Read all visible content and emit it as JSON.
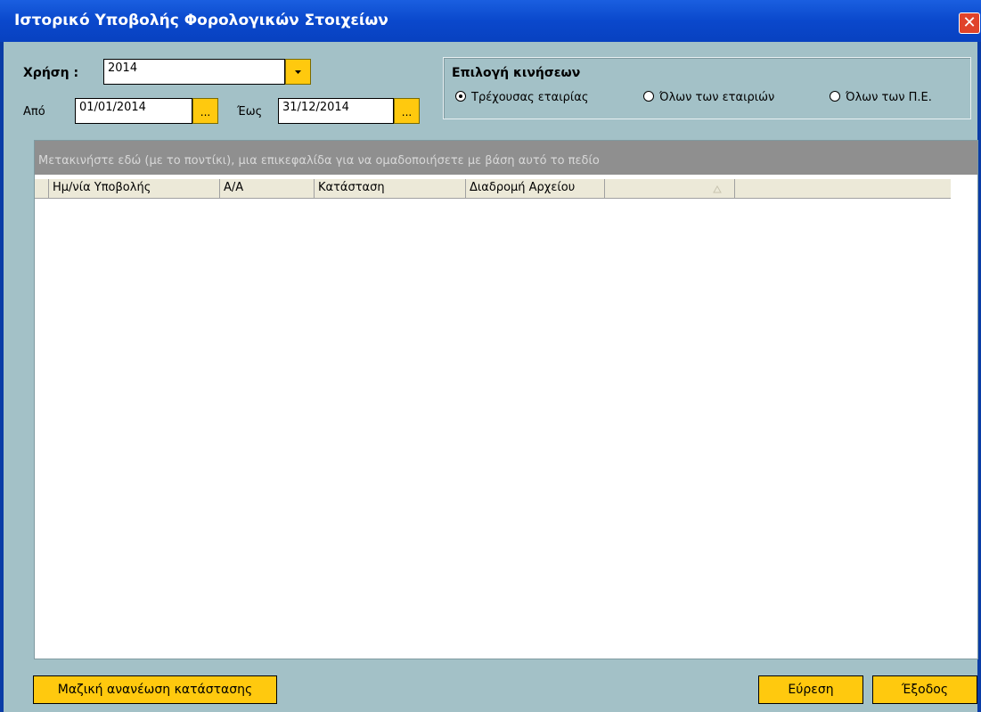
{
  "window": {
    "title": "Ιστορικό Υποβολής Φορολογικών Στοιχείων",
    "close_glyph": "✕"
  },
  "filters": {
    "year_label": "Χρήση :",
    "year_value": "2014",
    "from_label": "Από",
    "from_value": "01/01/2014",
    "to_label": "Έως",
    "to_value": "31/12/2014",
    "picker_glyph": "..."
  },
  "movement_selection": {
    "title": "Επιλογή κινήσεων",
    "options": [
      {
        "label": "Τρέχουσας εταιρίας",
        "selected": true
      },
      {
        "label": "Όλων των εταιριών",
        "selected": false
      },
      {
        "label": "Όλων των Π.Ε.",
        "selected": false
      }
    ]
  },
  "grid": {
    "group_hint": "Μετακινήστε εδώ (με το ποντίκι), μια επικεφαλίδα για να ομαδοποιήσετε με βάση αυτό το πεδίο",
    "columns": [
      "Ημ/νία Υποβολής",
      "Α/Α",
      "Κατάσταση",
      "Διαδρομή Αρχείου"
    ],
    "rows": []
  },
  "buttons": {
    "bulk_update": "Μαζική ανανέωση κατάστασης",
    "search": "Εύρεση",
    "exit": "Έξοδος"
  }
}
